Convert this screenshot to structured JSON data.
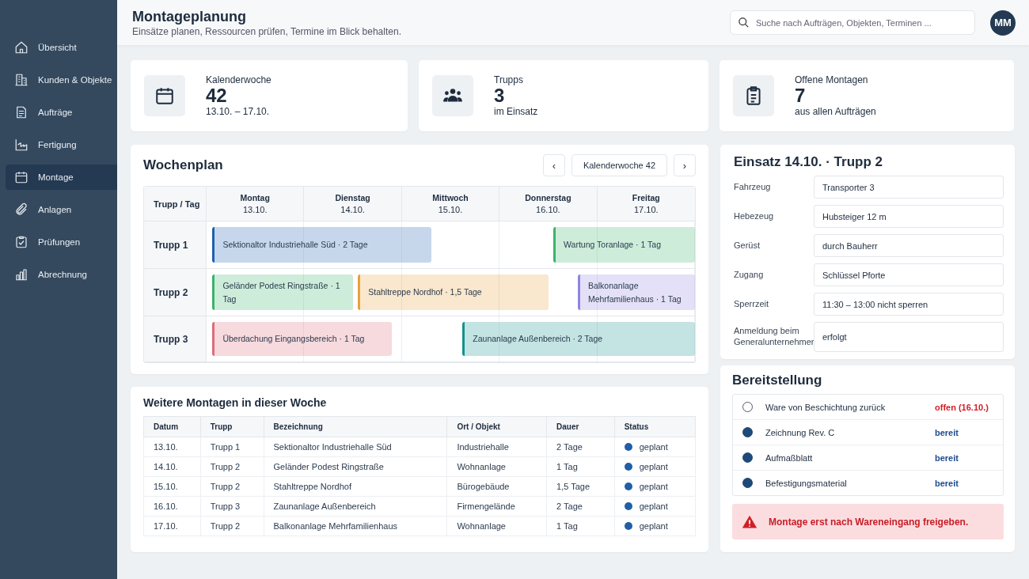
{
  "sidebar": {
    "items": [
      {
        "label": "Übersicht",
        "selected": false
      },
      {
        "label": "Kunden & Objekte",
        "selected": false
      },
      {
        "label": "Aufträge",
        "selected": false
      },
      {
        "label": "Fertigung",
        "selected": false
      },
      {
        "label": "Montage",
        "selected": true
      },
      {
        "label": "Anlagen",
        "selected": false
      },
      {
        "label": "Prüfungen",
        "selected": false
      },
      {
        "label": "Abrechnung",
        "selected": false
      }
    ]
  },
  "header": {
    "title": "Montageplanung",
    "subtitle": "Einsätze planen, Ressourcen prüfen, Termine im Blick behalten.",
    "search": {
      "placeholder": "Suche nach Aufträgen, Objekten, Terminen ..."
    },
    "avatar": "MM"
  },
  "stats": [
    {
      "label": "Kalenderwoche",
      "value": "42",
      "sub": "13.10. – 17.10."
    },
    {
      "label": "Trupps",
      "value": "3",
      "sub": "im Einsatz"
    },
    {
      "label": "Offene Montagen",
      "value": "7",
      "sub": "aus allen Aufträgen"
    }
  ],
  "weekplan": {
    "title": "Wochenplan",
    "prev": "‹",
    "week": "Kalenderwoche 42",
    "next": "›",
    "corner": "Trupp / Tag",
    "days": [
      {
        "name": "Montag",
        "date": "13.10."
      },
      {
        "name": "Dienstag",
        "date": "14.10."
      },
      {
        "name": "Mittwoch",
        "date": "15.10."
      },
      {
        "name": "Donnerstag",
        "date": "16.10."
      },
      {
        "name": "Freitag",
        "date": "17.10."
      }
    ],
    "rows": [
      {
        "label": "Trupp 1",
        "bars": [
          {
            "text": "Sektionaltor Industriehalle Süd · 2 Tage",
            "color": "#1f5fb0"
          },
          {
            "text": "Wartung Toranlage · 1 Tag",
            "color": "#3bb36a"
          }
        ]
      },
      {
        "label": "Trupp 2",
        "bars": [
          {
            "text": "Geländer Podest Ringstraße · 1 Tag",
            "color": "#3bb36a"
          },
          {
            "text": "Stahltreppe Nordhof · 1,5 Tage",
            "color": "#e9a13b"
          },
          {
            "text": "Balkonanlage Mehrfamilienhaus · 1 Tag",
            "color": "#8f84e0"
          }
        ]
      },
      {
        "label": "Trupp 3",
        "bars": [
          {
            "text": "Überdachung Eingangsbereich · 1 Tag",
            "color": "#e06b7a"
          },
          {
            "text": "Zaunanlage Außenbereich · 2 Tage",
            "color": "#13918f"
          }
        ]
      }
    ]
  },
  "more": {
    "title": "Weitere Montagen in dieser Woche",
    "columns": [
      "Datum",
      "Trupp",
      "Bezeichnung",
      "Ort / Objekt",
      "Dauer",
      "Status"
    ],
    "rows": [
      [
        "13.10.",
        "Trupp 1",
        "Sektionaltor Industriehalle Süd",
        "Industriehalle",
        "2 Tage",
        "geplant"
      ],
      [
        "14.10.",
        "Trupp 2",
        "Geländer Podest Ringstraße",
        "Wohnanlage",
        "1 Tag",
        "geplant"
      ],
      [
        "15.10.",
        "Trupp 2",
        "Stahltreppe Nordhof",
        "Bürogebäude",
        "1,5 Tage",
        "geplant"
      ],
      [
        "16.10.",
        "Trupp 3",
        "Zaunanlage Außenbereich",
        "Firmengelände",
        "2 Tage",
        "geplant"
      ],
      [
        "17.10.",
        "Trupp 2",
        "Balkonanlage Mehrfamilienhaus",
        "Wohnanlage",
        "1 Tag",
        "geplant"
      ]
    ]
  },
  "detail": {
    "title": "Einsatz 14.10. · Trupp 2",
    "fields": [
      {
        "label": "Fahrzeug",
        "value": "Transporter 3"
      },
      {
        "label": "Hebezeug",
        "value": "Hubsteiger 12 m"
      },
      {
        "label": "Gerüst",
        "value": "durch Bauherr"
      },
      {
        "label": "Zugang",
        "value": "Schlüssel Pforte"
      },
      {
        "label": "Sperrzeit",
        "value": "11:30 – 13:00 nicht sperren"
      },
      {
        "label": "Anmeldung beim Generalunternehmer",
        "value": "erfolgt"
      }
    ]
  },
  "provision": {
    "title": "Bereitstellung",
    "items": [
      {
        "label": "Ware von Beschichtung zurück",
        "status": "offen (16.10.)",
        "ready": false
      },
      {
        "label": "Zeichnung Rev. C",
        "status": "bereit",
        "ready": true
      },
      {
        "label": "Aufmaßblatt",
        "status": "bereit",
        "ready": true
      },
      {
        "label": "Befestigungsmaterial",
        "status": "bereit",
        "ready": true
      }
    ],
    "alert": "Montage erst nach Wareneingang freigeben."
  }
}
